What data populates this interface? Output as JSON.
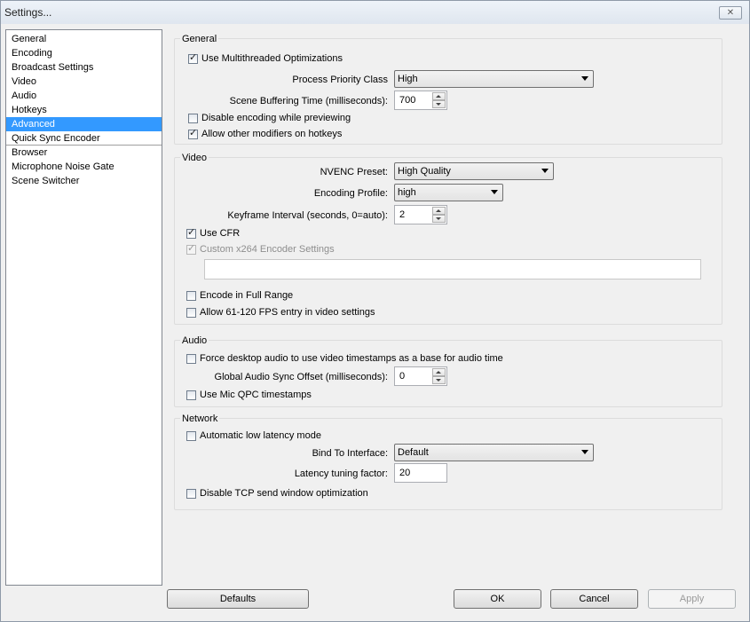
{
  "window": {
    "title": "Settings...",
    "close_glyph": "✕"
  },
  "sidebar": {
    "items": [
      {
        "label": "General"
      },
      {
        "label": "Encoding"
      },
      {
        "label": "Broadcast Settings"
      },
      {
        "label": "Video"
      },
      {
        "label": "Audio"
      },
      {
        "label": "Hotkeys"
      },
      {
        "label": "Advanced",
        "selected": true
      },
      {
        "label": "Quick Sync Encoder"
      },
      {
        "label": "Browser"
      },
      {
        "label": "Microphone Noise Gate"
      },
      {
        "label": "Scene Switcher"
      }
    ]
  },
  "general": {
    "title": "General",
    "multithreaded": "Use Multithreaded Optimizations",
    "priority_label": "Process Priority Class",
    "priority_value": "High",
    "buffering_label": "Scene Buffering Time (milliseconds):",
    "buffering_value": "700",
    "disable_encoding": "Disable encoding while previewing",
    "allow_modifiers": "Allow other modifiers on hotkeys"
  },
  "video": {
    "title": "Video",
    "nvenc_label": "NVENC Preset:",
    "nvenc_value": "High Quality",
    "profile_label": "Encoding Profile:",
    "profile_value": "high",
    "keyframe_label": "Keyframe Interval (seconds, 0=auto):",
    "keyframe_value": "2",
    "use_cfr": "Use CFR",
    "custom_x264": "Custom x264 Encoder Settings",
    "custom_x264_value": "",
    "full_range": "Encode in Full Range",
    "fps_entry": "Allow 61-120 FPS entry in video settings"
  },
  "audio": {
    "title": "Audio",
    "force_desktop": "Force desktop audio to use video timestamps as a base for audio time",
    "sync_label": "Global Audio Sync Offset (milliseconds):",
    "sync_value": "0",
    "mic_qpc": "Use Mic QPC timestamps"
  },
  "network": {
    "title": "Network",
    "low_latency": "Automatic low latency mode",
    "bind_label": "Bind To Interface:",
    "bind_value": "Default",
    "latency_label": "Latency tuning factor:",
    "latency_value": "20",
    "disable_tcp": "Disable TCP send window optimization"
  },
  "buttons": {
    "defaults": "Defaults",
    "ok": "OK",
    "cancel": "Cancel",
    "apply": "Apply"
  }
}
